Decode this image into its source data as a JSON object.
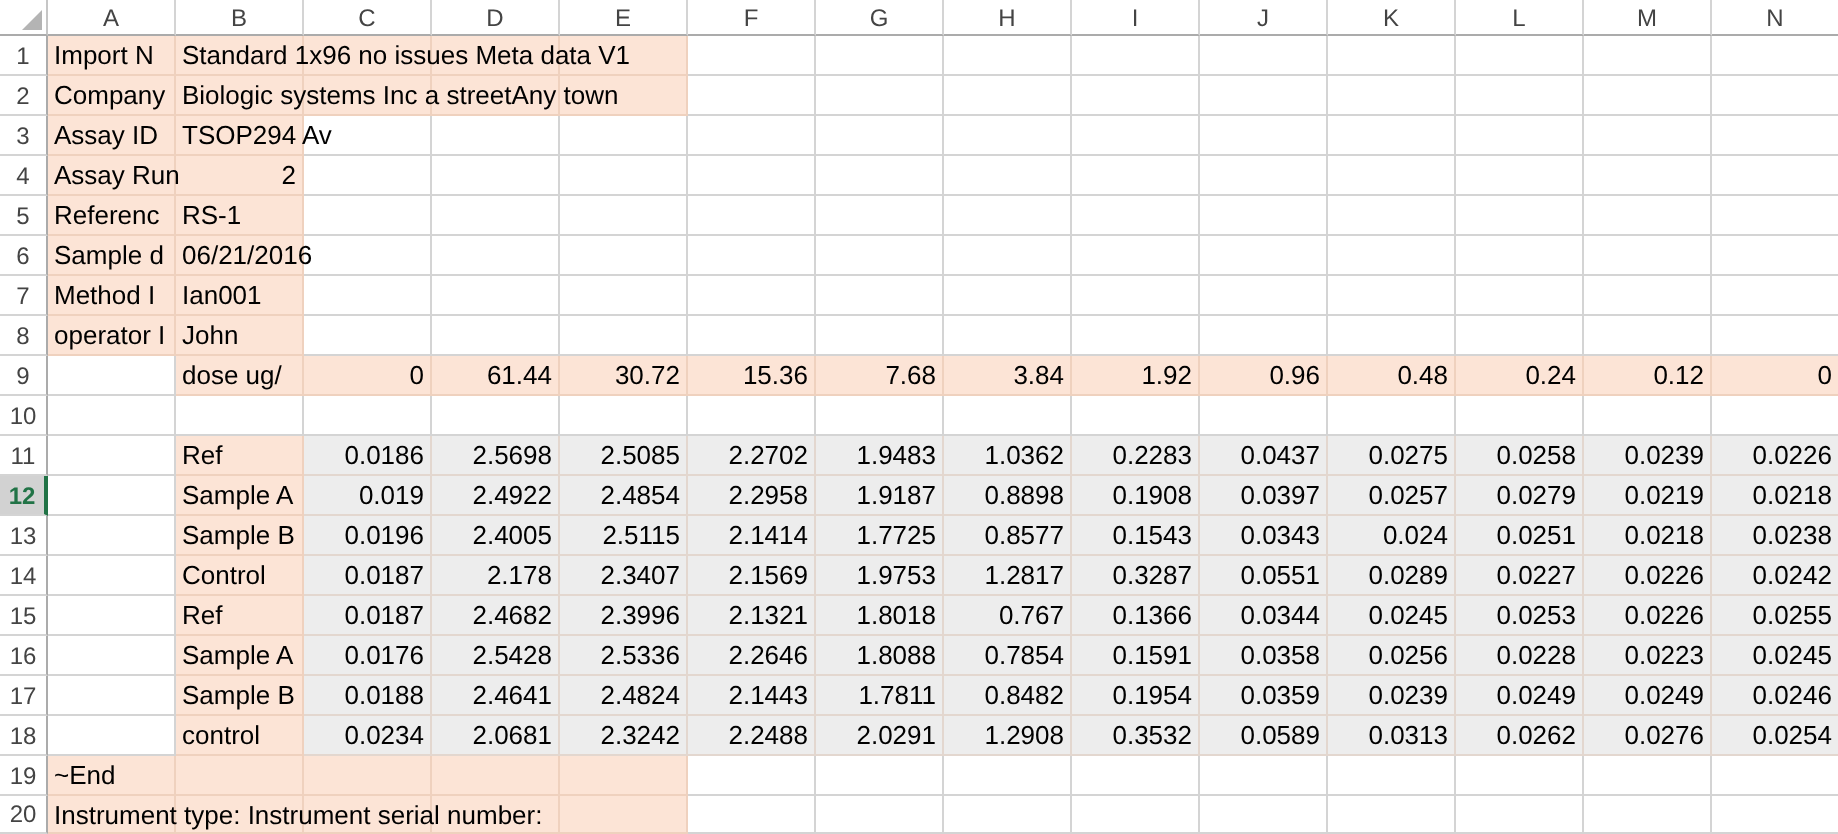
{
  "columns": [
    {
      "label": "A",
      "selected": false
    },
    {
      "label": "B",
      "selected": false
    },
    {
      "label": "C",
      "selected": false
    },
    {
      "label": "D",
      "selected": false
    },
    {
      "label": "E",
      "selected": false
    },
    {
      "label": "F",
      "selected": false
    },
    {
      "label": "G",
      "selected": false
    },
    {
      "label": "H",
      "selected": false
    },
    {
      "label": "I",
      "selected": false
    },
    {
      "label": "J",
      "selected": false
    },
    {
      "label": "K",
      "selected": false
    },
    {
      "label": "L",
      "selected": false
    },
    {
      "label": "M",
      "selected": false
    },
    {
      "label": "N",
      "selected": false
    }
  ],
  "rows": [
    {
      "number": "1",
      "selected": false,
      "cells": [
        {
          "text": "Import N",
          "kind": "text",
          "color": "#fce4d6"
        },
        {
          "text": "Standard 1x96 no issues Meta data V1",
          "kind": "text",
          "color": "#fce4d6"
        },
        {
          "color": "#fce4d6"
        },
        {
          "color": "#fce4d6"
        },
        {
          "color": "#fce4d6"
        },
        null,
        null,
        null,
        null,
        null,
        null,
        null,
        null,
        null
      ]
    },
    {
      "number": "2",
      "selected": false,
      "cells": [
        {
          "text": "Company",
          "kind": "text",
          "color": "#fce4d6"
        },
        {
          "text": "Biologic systems Inc a streetAny town",
          "kind": "text",
          "color": "#fce4d6"
        },
        {
          "color": "#fce4d6"
        },
        {
          "color": "#fce4d6"
        },
        {
          "color": "#fce4d6"
        },
        null,
        null,
        null,
        null,
        null,
        null,
        null,
        null,
        null
      ]
    },
    {
      "number": "3",
      "selected": false,
      "cells": [
        {
          "text": "Assay ID",
          "kind": "text",
          "color": "#fce4d6"
        },
        {
          "text": "TSOP294 Av",
          "kind": "text",
          "color": "#fce4d6"
        },
        null,
        null,
        null,
        null,
        null,
        null,
        null,
        null,
        null,
        null,
        null,
        null
      ]
    },
    {
      "number": "4",
      "selected": false,
      "cells": [
        {
          "text": "Assay Run",
          "kind": "text",
          "color": "#fce4d6"
        },
        {
          "text": "2",
          "kind": "number",
          "color": "#fce4d6"
        },
        null,
        null,
        null,
        null,
        null,
        null,
        null,
        null,
        null,
        null,
        null,
        null
      ]
    },
    {
      "number": "5",
      "selected": false,
      "cells": [
        {
          "text": "Referenc",
          "kind": "text",
          "color": "#fce4d6"
        },
        {
          "text": "RS-1",
          "kind": "text",
          "color": "#fce4d6"
        },
        null,
        null,
        null,
        null,
        null,
        null,
        null,
        null,
        null,
        null,
        null,
        null
      ]
    },
    {
      "number": "6",
      "selected": false,
      "cells": [
        {
          "text": "Sample d",
          "kind": "text",
          "color": "#fce4d6"
        },
        {
          "text": "06/21/2016",
          "kind": "text",
          "color": "#fce4d6"
        },
        null,
        null,
        null,
        null,
        null,
        null,
        null,
        null,
        null,
        null,
        null,
        null
      ]
    },
    {
      "number": "7",
      "selected": false,
      "cells": [
        {
          "text": "Method I",
          "kind": "text",
          "color": "#fce4d6"
        },
        {
          "text": "Ian001",
          "kind": "text",
          "color": "#fce4d6"
        },
        null,
        null,
        null,
        null,
        null,
        null,
        null,
        null,
        null,
        null,
        null,
        null
      ]
    },
    {
      "number": "8",
      "selected": false,
      "cells": [
        {
          "text": "operator I",
          "kind": "text",
          "color": "#fce4d6"
        },
        {
          "text": "John",
          "kind": "text",
          "color": "#fce4d6"
        },
        null,
        null,
        null,
        null,
        null,
        null,
        null,
        null,
        null,
        null,
        null,
        null
      ]
    },
    {
      "number": "9",
      "selected": false,
      "cells": [
        null,
        {
          "text": "dose ug/",
          "kind": "text",
          "color": "#fce4d6"
        },
        {
          "text": "0",
          "kind": "number",
          "color": "#fce4d6"
        },
        {
          "text": "61.44",
          "kind": "number",
          "color": "#fce4d6"
        },
        {
          "text": "30.72",
          "kind": "number",
          "color": "#fce4d6"
        },
        {
          "text": "15.36",
          "kind": "number",
          "color": "#fce4d6"
        },
        {
          "text": "7.68",
          "kind": "number",
          "color": "#fce4d6"
        },
        {
          "text": "3.84",
          "kind": "number",
          "color": "#fce4d6"
        },
        {
          "text": "1.92",
          "kind": "number",
          "color": "#fce4d6"
        },
        {
          "text": "0.96",
          "kind": "number",
          "color": "#fce4d6"
        },
        {
          "text": "0.48",
          "kind": "number",
          "color": "#fce4d6"
        },
        {
          "text": "0.24",
          "kind": "number",
          "color": "#fce4d6"
        },
        {
          "text": "0.12",
          "kind": "number",
          "color": "#fce4d6"
        },
        {
          "text": "0",
          "kind": "number",
          "color": "#fce4d6"
        }
      ]
    },
    {
      "number": "10",
      "selected": false,
      "cells": [
        null,
        null,
        null,
        null,
        null,
        null,
        null,
        null,
        null,
        null,
        null,
        null,
        null,
        null
      ]
    },
    {
      "number": "11",
      "selected": false,
      "cells": [
        null,
        {
          "text": "Ref",
          "kind": "text",
          "color": "#fce4d6"
        },
        {
          "text": "0.0186",
          "kind": "number",
          "color": "#ededed"
        },
        {
          "text": "2.5698",
          "kind": "number",
          "color": "#ededed"
        },
        {
          "text": "2.5085",
          "kind": "number",
          "color": "#ededed"
        },
        {
          "text": "2.2702",
          "kind": "number",
          "color": "#ededed"
        },
        {
          "text": "1.9483",
          "kind": "number",
          "color": "#ededed"
        },
        {
          "text": "1.0362",
          "kind": "number",
          "color": "#ededed"
        },
        {
          "text": "0.2283",
          "kind": "number",
          "color": "#ededed"
        },
        {
          "text": "0.0437",
          "kind": "number",
          "color": "#ededed"
        },
        {
          "text": "0.0275",
          "kind": "number",
          "color": "#ededed"
        },
        {
          "text": "0.0258",
          "kind": "number",
          "color": "#ededed"
        },
        {
          "text": "0.0239",
          "kind": "number",
          "color": "#ededed"
        },
        {
          "text": "0.0226",
          "kind": "number",
          "color": "#ededed"
        }
      ]
    },
    {
      "number": "12",
      "selected": true,
      "cells": [
        null,
        {
          "text": "Sample A",
          "kind": "text",
          "color": "#fce4d6"
        },
        {
          "text": "0.019",
          "kind": "number",
          "color": "#ededed"
        },
        {
          "text": "2.4922",
          "kind": "number",
          "color": "#ededed"
        },
        {
          "text": "2.4854",
          "kind": "number",
          "color": "#ededed"
        },
        {
          "text": "2.2958",
          "kind": "number",
          "color": "#ededed"
        },
        {
          "text": "1.9187",
          "kind": "number",
          "color": "#ededed"
        },
        {
          "text": "0.8898",
          "kind": "number",
          "color": "#ededed"
        },
        {
          "text": "0.1908",
          "kind": "number",
          "color": "#ededed"
        },
        {
          "text": "0.0397",
          "kind": "number",
          "color": "#ededed"
        },
        {
          "text": "0.0257",
          "kind": "number",
          "color": "#ededed"
        },
        {
          "text": "0.0279",
          "kind": "number",
          "color": "#ededed"
        },
        {
          "text": "0.0219",
          "kind": "number",
          "color": "#ededed"
        },
        {
          "text": "0.0218",
          "kind": "number",
          "color": "#ededed"
        }
      ]
    },
    {
      "number": "13",
      "selected": false,
      "cells": [
        null,
        {
          "text": "Sample B",
          "kind": "text",
          "color": "#fce4d6"
        },
        {
          "text": "0.0196",
          "kind": "number",
          "color": "#ededed"
        },
        {
          "text": "2.4005",
          "kind": "number",
          "color": "#ededed"
        },
        {
          "text": "2.5115",
          "kind": "number",
          "color": "#ededed"
        },
        {
          "text": "2.1414",
          "kind": "number",
          "color": "#ededed"
        },
        {
          "text": "1.7725",
          "kind": "number",
          "color": "#ededed"
        },
        {
          "text": "0.8577",
          "kind": "number",
          "color": "#ededed"
        },
        {
          "text": "0.1543",
          "kind": "number",
          "color": "#ededed"
        },
        {
          "text": "0.0343",
          "kind": "number",
          "color": "#ededed"
        },
        {
          "text": "0.024",
          "kind": "number",
          "color": "#ededed"
        },
        {
          "text": "0.0251",
          "kind": "number",
          "color": "#ededed"
        },
        {
          "text": "0.0218",
          "kind": "number",
          "color": "#ededed"
        },
        {
          "text": "0.0238",
          "kind": "number",
          "color": "#ededed"
        }
      ]
    },
    {
      "number": "14",
      "selected": false,
      "cells": [
        null,
        {
          "text": "Control",
          "kind": "text",
          "color": "#fce4d6"
        },
        {
          "text": "0.0187",
          "kind": "number",
          "color": "#ededed"
        },
        {
          "text": "2.178",
          "kind": "number",
          "color": "#ededed"
        },
        {
          "text": "2.3407",
          "kind": "number",
          "color": "#ededed"
        },
        {
          "text": "2.1569",
          "kind": "number",
          "color": "#ededed"
        },
        {
          "text": "1.9753",
          "kind": "number",
          "color": "#ededed"
        },
        {
          "text": "1.2817",
          "kind": "number",
          "color": "#ededed"
        },
        {
          "text": "0.3287",
          "kind": "number",
          "color": "#ededed"
        },
        {
          "text": "0.0551",
          "kind": "number",
          "color": "#ededed"
        },
        {
          "text": "0.0289",
          "kind": "number",
          "color": "#ededed"
        },
        {
          "text": "0.0227",
          "kind": "number",
          "color": "#ededed"
        },
        {
          "text": "0.0226",
          "kind": "number",
          "color": "#ededed"
        },
        {
          "text": "0.0242",
          "kind": "number",
          "color": "#ededed"
        }
      ]
    },
    {
      "number": "15",
      "selected": false,
      "cells": [
        null,
        {
          "text": "Ref",
          "kind": "text",
          "color": "#fce4d6"
        },
        {
          "text": "0.0187",
          "kind": "number",
          "color": "#ededed"
        },
        {
          "text": "2.4682",
          "kind": "number",
          "color": "#ededed"
        },
        {
          "text": "2.3996",
          "kind": "number",
          "color": "#ededed"
        },
        {
          "text": "2.1321",
          "kind": "number",
          "color": "#ededed"
        },
        {
          "text": "1.8018",
          "kind": "number",
          "color": "#ededed"
        },
        {
          "text": "0.767",
          "kind": "number",
          "color": "#ededed"
        },
        {
          "text": "0.1366",
          "kind": "number",
          "color": "#ededed"
        },
        {
          "text": "0.0344",
          "kind": "number",
          "color": "#ededed"
        },
        {
          "text": "0.0245",
          "kind": "number",
          "color": "#ededed"
        },
        {
          "text": "0.0253",
          "kind": "number",
          "color": "#ededed"
        },
        {
          "text": "0.0226",
          "kind": "number",
          "color": "#ededed"
        },
        {
          "text": "0.0255",
          "kind": "number",
          "color": "#ededed"
        }
      ]
    },
    {
      "number": "16",
      "selected": false,
      "cells": [
        null,
        {
          "text": "Sample A",
          "kind": "text",
          "color": "#fce4d6"
        },
        {
          "text": "0.0176",
          "kind": "number",
          "color": "#ededed"
        },
        {
          "text": "2.5428",
          "kind": "number",
          "color": "#ededed"
        },
        {
          "text": "2.5336",
          "kind": "number",
          "color": "#ededed"
        },
        {
          "text": "2.2646",
          "kind": "number",
          "color": "#ededed"
        },
        {
          "text": "1.8088",
          "kind": "number",
          "color": "#ededed"
        },
        {
          "text": "0.7854",
          "kind": "number",
          "color": "#ededed"
        },
        {
          "text": "0.1591",
          "kind": "number",
          "color": "#ededed"
        },
        {
          "text": "0.0358",
          "kind": "number",
          "color": "#ededed"
        },
        {
          "text": "0.0256",
          "kind": "number",
          "color": "#ededed"
        },
        {
          "text": "0.0228",
          "kind": "number",
          "color": "#ededed"
        },
        {
          "text": "0.0223",
          "kind": "number",
          "color": "#ededed"
        },
        {
          "text": "0.0245",
          "kind": "number",
          "color": "#ededed"
        }
      ]
    },
    {
      "number": "17",
      "selected": false,
      "cells": [
        null,
        {
          "text": "Sample B",
          "kind": "text",
          "color": "#fce4d6"
        },
        {
          "text": "0.0188",
          "kind": "number",
          "color": "#ededed"
        },
        {
          "text": "2.4641",
          "kind": "number",
          "color": "#ededed"
        },
        {
          "text": "2.4824",
          "kind": "number",
          "color": "#ededed"
        },
        {
          "text": "2.1443",
          "kind": "number",
          "color": "#ededed"
        },
        {
          "text": "1.7811",
          "kind": "number",
          "color": "#ededed"
        },
        {
          "text": "0.8482",
          "kind": "number",
          "color": "#ededed"
        },
        {
          "text": "0.1954",
          "kind": "number",
          "color": "#ededed"
        },
        {
          "text": "0.0359",
          "kind": "number",
          "color": "#ededed"
        },
        {
          "text": "0.0239",
          "kind": "number",
          "color": "#ededed"
        },
        {
          "text": "0.0249",
          "kind": "number",
          "color": "#ededed"
        },
        {
          "text": "0.0249",
          "kind": "number",
          "color": "#ededed"
        },
        {
          "text": "0.0246",
          "kind": "number",
          "color": "#ededed"
        }
      ]
    },
    {
      "number": "18",
      "selected": false,
      "cells": [
        null,
        {
          "text": "control",
          "kind": "text",
          "color": "#fce4d6"
        },
        {
          "text": "0.0234",
          "kind": "number",
          "color": "#ededed"
        },
        {
          "text": "2.0681",
          "kind": "number",
          "color": "#ededed"
        },
        {
          "text": "2.3242",
          "kind": "number",
          "color": "#ededed"
        },
        {
          "text": "2.2488",
          "kind": "number",
          "color": "#ededed"
        },
        {
          "text": "2.0291",
          "kind": "number",
          "color": "#ededed"
        },
        {
          "text": "1.2908",
          "kind": "number",
          "color": "#ededed"
        },
        {
          "text": "0.3532",
          "kind": "number",
          "color": "#ededed"
        },
        {
          "text": "0.0589",
          "kind": "number",
          "color": "#ededed"
        },
        {
          "text": "0.0313",
          "kind": "number",
          "color": "#ededed"
        },
        {
          "text": "0.0262",
          "kind": "number",
          "color": "#ededed"
        },
        {
          "text": "0.0276",
          "kind": "number",
          "color": "#ededed"
        },
        {
          "text": "0.0254",
          "kind": "number",
          "color": "#ededed"
        }
      ]
    },
    {
      "number": "19",
      "selected": false,
      "cells": [
        {
          "text": "~End",
          "kind": "text",
          "color": "#fce4d6"
        },
        {
          "color": "#fce4d6"
        },
        {
          "color": "#fce4d6"
        },
        {
          "color": "#fce4d6"
        },
        {
          "color": "#fce4d6"
        },
        null,
        null,
        null,
        null,
        null,
        null,
        null,
        null,
        null
      ]
    },
    {
      "number": "20",
      "selected": false,
      "cells": [
        {
          "text": "Instrument type: Instrument serial number:",
          "kind": "text",
          "color": "#fce4d6"
        },
        {
          "color": "#fce4d6"
        },
        {
          "color": "#fce4d6"
        },
        {
          "color": "#fce4d6"
        },
        {
          "color": "#fce4d6"
        },
        null,
        null,
        null,
        null,
        null,
        null,
        null,
        null,
        null
      ]
    }
  ]
}
